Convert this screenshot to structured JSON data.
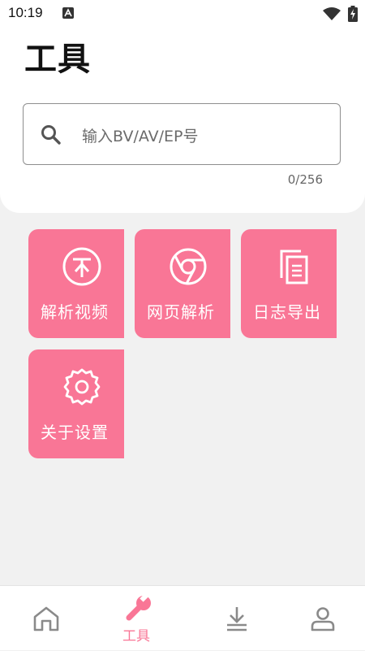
{
  "status_bar": {
    "time": "10:19",
    "icons": [
      "notification-a-icon",
      "wifi-icon",
      "battery-charging-icon"
    ]
  },
  "header": {
    "title": "工具"
  },
  "search": {
    "placeholder": "输入BV/AV/EP号",
    "value": "",
    "counter": "0/256"
  },
  "tools": [
    {
      "label": "解析视频",
      "icon": "video-parse-icon"
    },
    {
      "label": "网页解析",
      "icon": "chrome-icon"
    },
    {
      "label": "日志导出",
      "icon": "document-copy-icon"
    },
    {
      "label": "关于设置",
      "icon": "gear-icon"
    }
  ],
  "bottom_nav": {
    "items": [
      {
        "id": "home",
        "icon": "home-icon",
        "label": ""
      },
      {
        "id": "tools",
        "icon": "wrench-icon",
        "label": "工具",
        "active": true
      },
      {
        "id": "download",
        "icon": "download-icon",
        "label": ""
      },
      {
        "id": "profile",
        "icon": "user-icon",
        "label": ""
      }
    ]
  },
  "colors": {
    "accent": "#f97696",
    "nav_inactive": "#8a8a8a",
    "background": "#f1f1f1"
  }
}
